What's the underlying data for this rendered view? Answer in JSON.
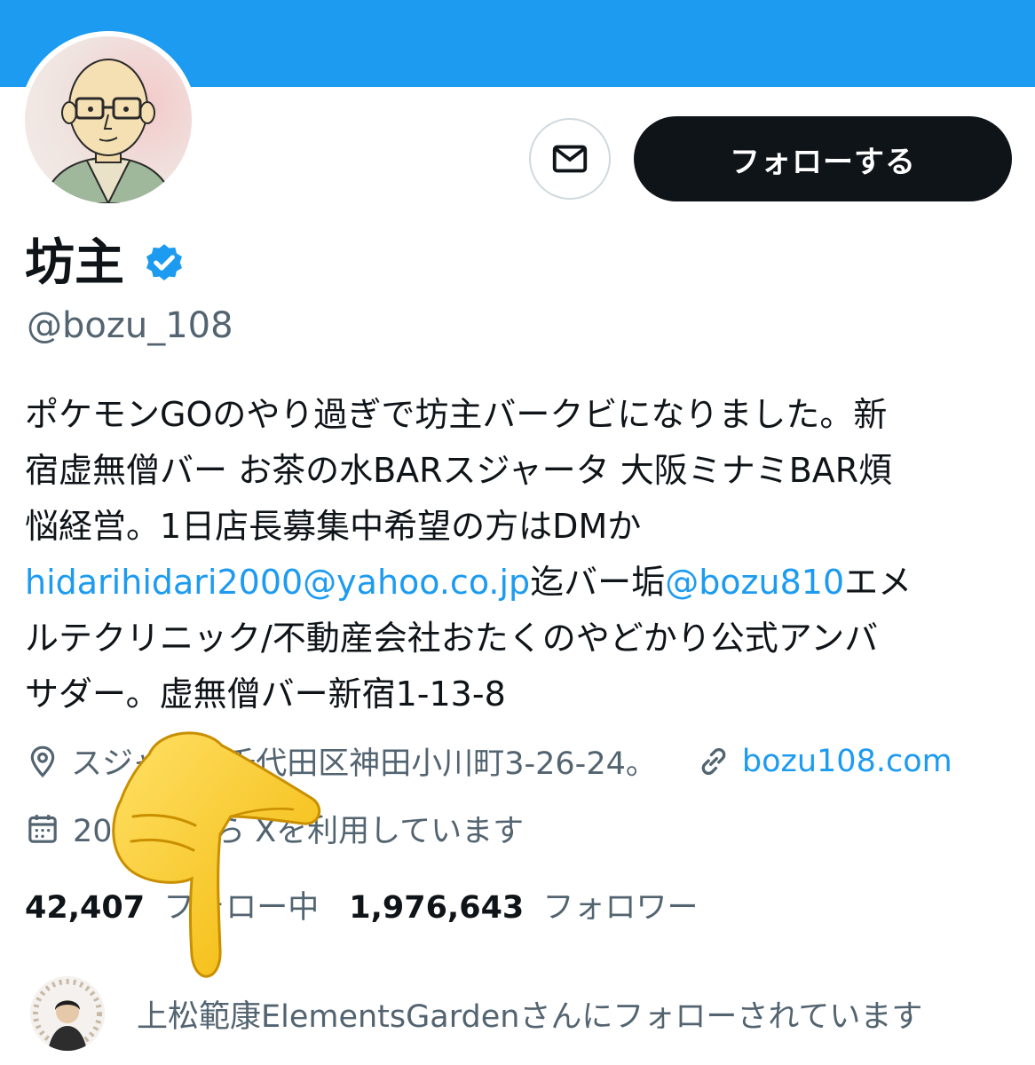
{
  "profile": {
    "display_name": "坊主",
    "handle": "@bozu_108",
    "verified_icon": "verified-badge-icon",
    "bio": {
      "line1": "ポケモンGOのやり過ぎで坊主バークビになりました。新",
      "line2": "宿虚無僧バー お茶の水BARスジャータ 大阪ミナミBAR煩",
      "line3": "悩経営。1日店長募集中希望の方はDMか",
      "email_link": "hidarihidari2000@yahoo.co.jp",
      "after_email": "迄バー垢",
      "mention_link": "@bozu810",
      "after_mention": "エメ",
      "line5": "ルテクリニック/不動産会社おたくのやどかり公式アンバ",
      "line6": "サダー。虚無僧バー新宿1-13-8"
    },
    "location": "スジャータ千代田区神田小川町3-26-24。",
    "website": "bozu108.com",
    "joined": "2010年から Xを利用しています",
    "following_count": "42,407",
    "following_label": "フォロー中",
    "followers_count": "1,976,643",
    "followers_label": "フォロワー",
    "followed_by": "上松範康ElementsGardenさんにフォローされています"
  },
  "actions": {
    "message_icon": "envelope-icon",
    "follow_label": "フォローする"
  },
  "colors": {
    "banner": "#1d9bf0",
    "link": "#1d9bf0",
    "secondary_text": "#536471",
    "primary_text": "#0f1419",
    "follow_button": "#0f1419"
  }
}
